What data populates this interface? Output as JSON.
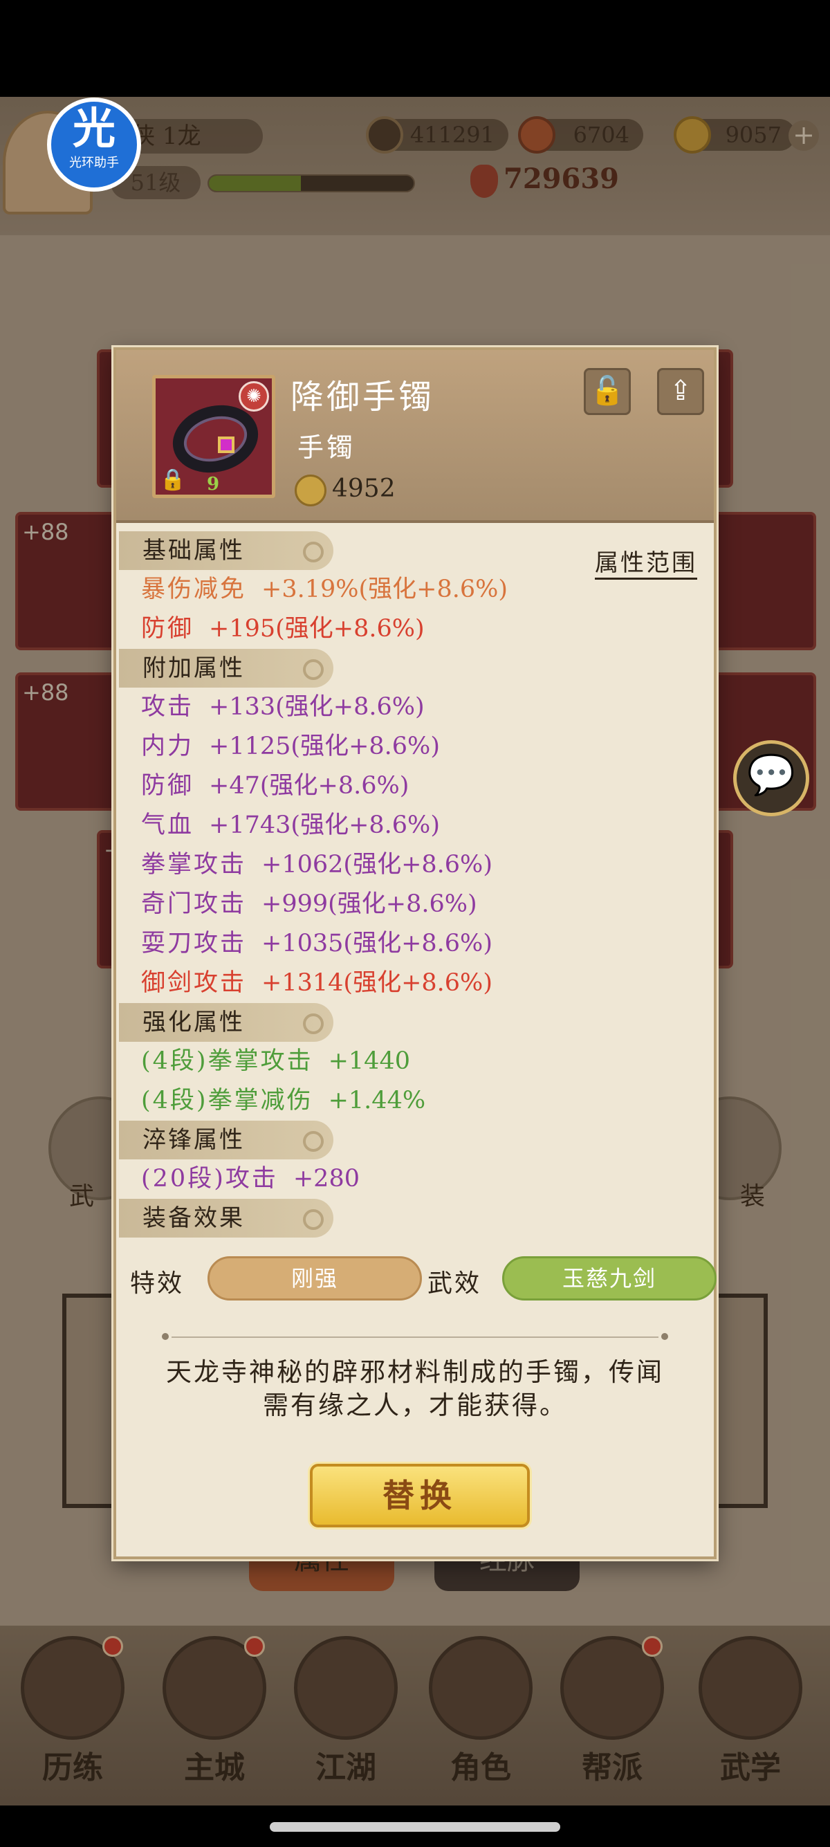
{
  "status_bar": {},
  "badge": {
    "glyph": "光",
    "text": "光环助手"
  },
  "player": {
    "name": "侠 1龙",
    "level": "51级",
    "exp_fraction": 0.45,
    "power": "729639"
  },
  "currencies": [
    {
      "icon": "copper-coin-icon",
      "value": "411291"
    },
    {
      "icon": "spirit-icon",
      "value": "6704"
    },
    {
      "icon": "gold-ingot-icon",
      "value": "9057"
    }
  ],
  "background": {
    "slot_levels": [
      "+88",
      "+88",
      "+"
    ],
    "side_labels": {
      "left": "武",
      "right": "装"
    },
    "tabs": [
      "属性",
      "经脉"
    ]
  },
  "navbar": [
    {
      "label": "历练",
      "dot": true
    },
    {
      "label": "主城",
      "dot": true
    },
    {
      "label": "江湖",
      "dot": false
    },
    {
      "label": "角色",
      "dot": false
    },
    {
      "label": "帮派",
      "dot": true
    },
    {
      "label": "武学",
      "dot": false
    }
  ],
  "item": {
    "name": "降御手镯",
    "type": "手镯",
    "score": "4952",
    "grade": "9",
    "colors": {
      "frame": "#7d2630",
      "gem": "#d22ec9"
    }
  },
  "sections": {
    "base": "基础属性",
    "extra": "附加属性",
    "enhance": "强化属性",
    "temper": "淬锋属性",
    "effect": "装备效果",
    "range_link": "属性范围"
  },
  "base_attrs": [
    {
      "label": "暴伤减免",
      "value": "+3.19%(强化+8.6%)",
      "color": "orange"
    },
    {
      "label": "防御",
      "value": "+195(强化+8.6%)",
      "color": "red"
    }
  ],
  "extra_attrs": [
    {
      "label": "攻击",
      "value": "+133(强化+8.6%)"
    },
    {
      "label": "内力",
      "value": "+1125(强化+8.6%)"
    },
    {
      "label": "防御",
      "value": "+47(强化+8.6%)"
    },
    {
      "label": "气血",
      "value": "+1743(强化+8.6%)"
    },
    {
      "label": "拳掌攻击",
      "value": "+1062(强化+8.6%)"
    },
    {
      "label": "奇门攻击",
      "value": "+999(强化+8.6%)"
    },
    {
      "label": "耍刀攻击",
      "value": "+1035(强化+8.6%)"
    },
    {
      "label": "御剑攻击",
      "value": "+1314(强化+8.6%)",
      "color": "red"
    }
  ],
  "enhance_attrs": [
    {
      "label": "(4段)拳掌攻击",
      "value": "+1440"
    },
    {
      "label": "(4段)拳掌减伤",
      "value": "+1.44%"
    }
  ],
  "temper_attrs": [
    {
      "label": "(20段)攻击",
      "value": "+280"
    }
  ],
  "effects": {
    "special_label": "特效",
    "special_value": "刚强",
    "martial_label": "武效",
    "martial_value": "玉慈九剑"
  },
  "description": "天龙寺神秘的辟邪材料制成的手镯，传闻需有缘之人，才能获得。",
  "replace_button": "替换"
}
